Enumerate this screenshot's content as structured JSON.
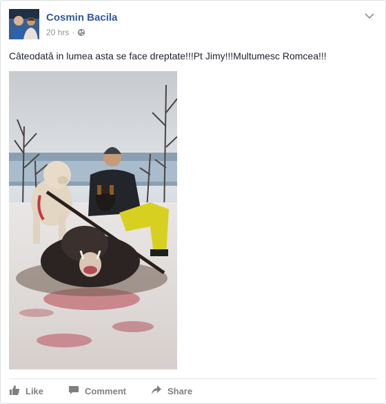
{
  "post": {
    "author": "Cosmin Bacila",
    "time": "20 hrs",
    "separator": "·",
    "privacy_icon": "globe-icon",
    "message": "Câteodată in lumea asta se face dreptate!!!Pt Jimy!!!Multumesc Romcea!!!",
    "menu_icon": "chevron-down-icon"
  },
  "actions": {
    "like_label": "Like",
    "comment_label": "Comment",
    "share_label": "Share"
  },
  "colors": {
    "author_link": "#365899",
    "meta_text": "#90949c",
    "action_text": "#7f7f7f"
  }
}
